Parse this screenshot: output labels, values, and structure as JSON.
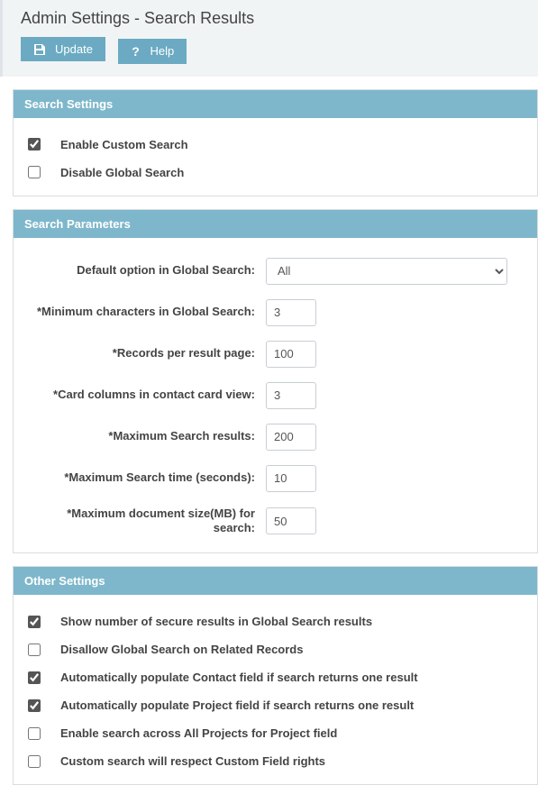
{
  "page": {
    "title": "Admin Settings - Search Results"
  },
  "toolbar": {
    "update_label": "Update",
    "help_label": "Help"
  },
  "sections": {
    "search_settings": {
      "header": "Search Settings",
      "enable_custom_search": {
        "label": "Enable Custom Search",
        "checked": true
      },
      "disable_global_search": {
        "label": "Disable Global Search",
        "checked": false
      }
    },
    "search_parameters": {
      "header": "Search Parameters",
      "default_option": {
        "label": "Default option in Global Search:",
        "value": "All"
      },
      "min_chars": {
        "label": "*Minimum characters in Global Search:",
        "value": "3"
      },
      "records_per_page": {
        "label": "*Records per result page:",
        "value": "100"
      },
      "card_columns": {
        "label": "*Card columns in contact card view:",
        "value": "3"
      },
      "max_results": {
        "label": "*Maximum Search results:",
        "value": "200"
      },
      "max_time": {
        "label": "*Maximum Search time (seconds):",
        "value": "10"
      },
      "max_doc_size": {
        "label": "*Maximum document size(MB) for search:",
        "value": "50"
      }
    },
    "other_settings": {
      "header": "Other Settings",
      "show_secure_count": {
        "label": "Show number of secure results in Global Search results",
        "checked": true
      },
      "disallow_related": {
        "label": "Disallow Global Search on Related Records",
        "checked": false
      },
      "auto_contact": {
        "label": "Automatically populate Contact field if search returns one result",
        "checked": true
      },
      "auto_project": {
        "label": "Automatically populate Project field if search returns one result",
        "checked": true
      },
      "search_all_projects": {
        "label": "Enable search across All Projects for Project field",
        "checked": false
      },
      "respect_custom_field": {
        "label": "Custom search will respect Custom Field rights",
        "checked": false
      }
    }
  }
}
